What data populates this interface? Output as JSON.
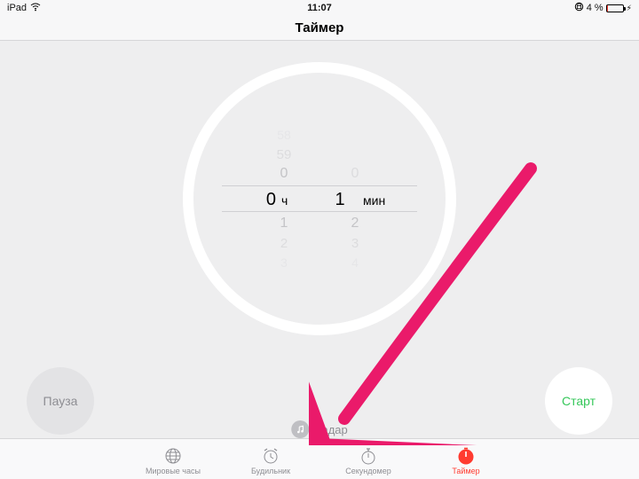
{
  "statusbar": {
    "device": "iPad",
    "time": "11:07",
    "battery_percent": "4 %"
  },
  "title": "Таймер",
  "picker": {
    "hours_above": {
      "f3": "58",
      "f2": "59",
      "f1": "0"
    },
    "hours_selected": "0",
    "hours_unit": "ч",
    "minutes_selected": "1",
    "minutes_unit": "мин",
    "below": [
      {
        "h": "1",
        "m": "2"
      },
      {
        "h": "2",
        "m": "3"
      },
      {
        "h": "3",
        "m": "4"
      }
    ]
  },
  "buttons": {
    "pause": "Пауза",
    "start": "Старт"
  },
  "sound": {
    "label": "Радар"
  },
  "tabs": {
    "world": "Мировые часы",
    "alarm": "Будильник",
    "stopwatch": "Секундомер",
    "timer": "Таймер"
  },
  "colors": {
    "accent_red": "#ff3b30",
    "start_green": "#34c759",
    "annotation_pink": "#ea1a6a"
  }
}
